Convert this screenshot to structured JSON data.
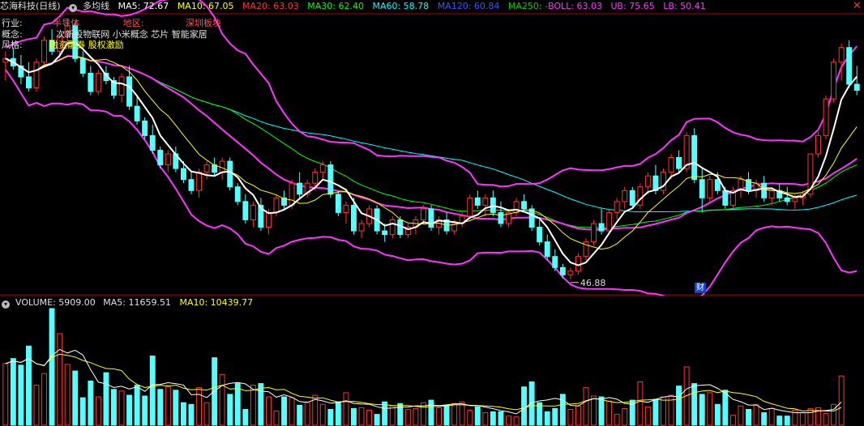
{
  "header": {
    "stock_title": "芯海科技(日线)",
    "indicator_name": "多均线",
    "ma_values": [
      {
        "label": "MA5: 72.67",
        "color": "#ffffff"
      },
      {
        "label": "MA10: 67.05",
        "color": "#ffff00"
      },
      {
        "label": "MA20: 63.03",
        "color": "#ff3333"
      },
      {
        "label": "MA30: 62.40",
        "color": "#00ff00"
      },
      {
        "label": "MA60: 58.78",
        "color": "#00ffff"
      },
      {
        "label": "MA120: 60.84",
        "color": "#3355ff"
      },
      {
        "label": "MA250: -",
        "color": "#00cc00"
      }
    ],
    "boll": {
      "label": "BOLL: 63.03",
      "ub": "UB: 75.65",
      "lb": "LB: 50.41",
      "color": "#ff33ff"
    }
  },
  "info": {
    "industry_label": "行业:",
    "industry_value": "半导体",
    "region_label": "地区:",
    "region_value": "深圳板块",
    "concept_label": "概念:",
    "concept_value": "次新股物联网 小米概念 芯片 智能家居",
    "style_label": "风格:",
    "style_value": "融资融券 股权激励"
  },
  "annotations": {
    "low_marker": "46.88",
    "finance_badge": "财"
  },
  "volume": {
    "label": "VOLUME: 5909.00",
    "ma5": "MA5: 11659.51",
    "ma10": "MA10: 10439.77"
  },
  "colors": {
    "up": "#ff3232",
    "down": "#54ffff",
    "ma5": "#ffffff",
    "ma10": "#ffff00",
    "ma30": "#00ff00",
    "ma60": "#00ffff",
    "ma120": "#3355ff",
    "boll": "#ff33ff",
    "frame": "#b40000"
  },
  "chart_data": {
    "type": "candlestick",
    "title": "芯海科技(日线)",
    "price_range": [
      45,
      83
    ],
    "candles": [
      [
        76.5,
        78.0,
        74.0,
        77.0
      ],
      [
        77.0,
        78.5,
        75.5,
        76.0
      ],
      [
        76.0,
        77.5,
        73.5,
        74.5
      ],
      [
        74.5,
        76.5,
        72.5,
        73.0
      ],
      [
        73.0,
        77.0,
        72.5,
        76.5
      ],
      [
        76.5,
        80.0,
        76.0,
        79.5
      ],
      [
        79.5,
        81.0,
        77.5,
        78.0
      ],
      [
        78.0,
        80.5,
        77.0,
        80.0
      ],
      [
        80.0,
        82.5,
        78.5,
        81.5
      ],
      [
        81.5,
        82.0,
        76.5,
        77.0
      ],
      [
        77.0,
        78.0,
        74.5,
        75.0
      ],
      [
        75.0,
        76.0,
        72.0,
        72.5
      ],
      [
        72.5,
        75.5,
        72.0,
        75.0
      ],
      [
        75.0,
        76.0,
        73.5,
        74.0
      ],
      [
        74.0,
        74.5,
        71.5,
        72.0
      ],
      [
        72.0,
        75.0,
        71.0,
        74.5
      ],
      [
        74.5,
        76.0,
        70.0,
        70.5
      ],
      [
        70.5,
        72.0,
        68.0,
        68.5
      ],
      [
        68.5,
        69.0,
        66.0,
        66.5
      ],
      [
        66.5,
        68.0,
        64.0,
        64.5
      ],
      [
        64.5,
        65.0,
        62.0,
        62.5
      ],
      [
        62.5,
        64.5,
        61.5,
        64.0
      ],
      [
        64.0,
        65.0,
        61.5,
        62.0
      ],
      [
        62.0,
        63.0,
        60.0,
        60.5
      ],
      [
        60.5,
        61.5,
        58.5,
        59.0
      ],
      [
        59.0,
        62.0,
        58.0,
        61.5
      ],
      [
        61.5,
        63.0,
        60.5,
        62.5
      ],
      [
        62.5,
        63.5,
        61.0,
        61.5
      ],
      [
        61.5,
        63.5,
        60.5,
        63.0
      ],
      [
        63.0,
        63.5,
        59.0,
        59.5
      ],
      [
        59.5,
        60.0,
        57.0,
        57.5
      ],
      [
        57.5,
        58.5,
        54.5,
        55.0
      ],
      [
        55.0,
        57.5,
        54.0,
        57.0
      ],
      [
        57.0,
        58.0,
        53.5,
        54.0
      ],
      [
        54.0,
        56.5,
        53.0,
        56.0
      ],
      [
        56.0,
        58.5,
        55.5,
        58.0
      ],
      [
        58.0,
        59.0,
        56.5,
        57.0
      ],
      [
        57.0,
        60.5,
        56.5,
        60.0
      ],
      [
        60.0,
        61.5,
        58.0,
        58.5
      ],
      [
        58.5,
        60.5,
        58.0,
        60.0
      ],
      [
        60.0,
        62.0,
        59.0,
        61.5
      ],
      [
        61.5,
        63.0,
        60.5,
        62.5
      ],
      [
        62.5,
        63.0,
        58.0,
        58.5
      ],
      [
        58.5,
        59.0,
        55.5,
        56.0
      ],
      [
        56.0,
        57.5,
        54.5,
        57.0
      ],
      [
        57.0,
        58.0,
        53.0,
        53.5
      ],
      [
        53.5,
        55.0,
        52.5,
        54.5
      ],
      [
        54.5,
        57.0,
        54.0,
        56.5
      ],
      [
        56.5,
        57.0,
        53.0,
        53.5
      ],
      [
        53.5,
        54.5,
        52.0,
        53.0
      ],
      [
        53.0,
        55.5,
        52.5,
        55.0
      ],
      [
        55.0,
        55.5,
        52.5,
        53.0
      ],
      [
        53.0,
        54.5,
        52.5,
        54.0
      ],
      [
        54.0,
        55.5,
        53.0,
        55.0
      ],
      [
        55.0,
        57.0,
        54.5,
        56.5
      ],
      [
        56.5,
        57.0,
        53.5,
        54.0
      ],
      [
        54.0,
        55.5,
        53.0,
        55.0
      ],
      [
        55.0,
        56.0,
        53.0,
        53.5
      ],
      [
        53.5,
        55.0,
        53.0,
        54.5
      ],
      [
        54.5,
        56.0,
        54.0,
        55.5
      ],
      [
        55.5,
        58.5,
        55.0,
        58.0
      ],
      [
        58.0,
        59.0,
        56.5,
        57.0
      ],
      [
        57.0,
        58.5,
        55.5,
        58.0
      ],
      [
        58.0,
        59.0,
        55.5,
        56.0
      ],
      [
        56.0,
        57.5,
        54.0,
        54.5
      ],
      [
        54.5,
        56.5,
        54.0,
        56.0
      ],
      [
        56.0,
        58.0,
        55.5,
        57.5
      ],
      [
        57.5,
        58.5,
        56.0,
        56.5
      ],
      [
        56.5,
        57.0,
        53.5,
        54.0
      ],
      [
        54.0,
        55.0,
        51.5,
        52.0
      ],
      [
        52.0,
        53.0,
        49.5,
        50.0
      ],
      [
        50.0,
        51.0,
        48.0,
        48.5
      ],
      [
        48.5,
        49.0,
        47.0,
        47.5
      ],
      [
        47.5,
        48.5,
        46.9,
        48.0
      ],
      [
        48.0,
        50.5,
        47.5,
        50.0
      ],
      [
        50.0,
        52.5,
        49.5,
        52.0
      ],
      [
        52.0,
        55.0,
        51.5,
        54.5
      ],
      [
        54.5,
        56.5,
        53.0,
        53.5
      ],
      [
        53.5,
        56.5,
        53.0,
        56.0
      ],
      [
        56.0,
        58.0,
        55.0,
        57.5
      ],
      [
        57.5,
        59.5,
        56.5,
        59.0
      ],
      [
        59.0,
        59.5,
        56.5,
        57.0
      ],
      [
        57.0,
        60.0,
        56.5,
        59.5
      ],
      [
        59.5,
        61.5,
        58.5,
        61.0
      ],
      [
        61.0,
        62.5,
        58.5,
        59.0
      ],
      [
        59.0,
        62.0,
        58.5,
        61.5
      ],
      [
        61.5,
        64.0,
        60.5,
        63.5
      ],
      [
        63.5,
        64.5,
        61.5,
        62.0
      ],
      [
        62.0,
        67.0,
        61.5,
        66.5
      ],
      [
        66.5,
        67.5,
        60.0,
        60.5
      ],
      [
        60.5,
        62.0,
        56.0,
        58.0
      ],
      [
        58.0,
        61.0,
        57.5,
        60.5
      ],
      [
        60.5,
        61.5,
        58.5,
        59.0
      ],
      [
        59.0,
        59.5,
        56.5,
        57.0
      ],
      [
        57.0,
        59.5,
        56.5,
        59.0
      ],
      [
        59.0,
        61.0,
        58.0,
        60.5
      ],
      [
        60.5,
        61.5,
        58.5,
        59.0
      ],
      [
        59.0,
        60.5,
        58.0,
        60.0
      ],
      [
        60.0,
        61.0,
        57.5,
        58.0
      ],
      [
        58.0,
        59.5,
        57.0,
        59.0
      ],
      [
        59.0,
        60.0,
        57.5,
        58.0
      ],
      [
        58.0,
        59.5,
        57.0,
        57.5
      ],
      [
        57.5,
        58.5,
        56.5,
        58.0
      ],
      [
        58.0,
        59.0,
        57.0,
        58.5
      ],
      [
        58.5,
        64.0,
        58.0,
        64.0
      ],
      [
        64.0,
        67.0,
        63.5,
        66.5
      ],
      [
        66.5,
        72.0,
        66.0,
        71.5
      ],
      [
        71.5,
        77.0,
        71.0,
        76.5
      ],
      [
        76.5,
        79.0,
        74.0,
        78.5
      ],
      [
        78.5,
        79.5,
        73.0,
        73.5
      ],
      [
        73.5,
        76.0,
        72.0,
        72.67
      ]
    ],
    "low_marker_value": 46.88,
    "volume_range": [
      0,
      14000
    ],
    "volume": [
      7400,
      8000,
      7200,
      9500,
      4800,
      6200,
      14000,
      11000,
      7300,
      6500,
      3300,
      5300,
      3400,
      6300,
      4300,
      4100,
      3600,
      4800,
      3500,
      8300,
      4300,
      4600,
      4200,
      2700,
      2500,
      4500,
      2700,
      8100,
      6100,
      3700,
      5000,
      1900,
      4800,
      5000,
      3400,
      1700,
      3400,
      3300,
      2400,
      2800,
      3600,
      2500,
      1900,
      2800,
      3900,
      2000,
      2100,
      1800,
      1300,
      2800,
      2300,
      2600,
      1900,
      2000,
      2700,
      3000,
      2100,
      2400,
      2600,
      2800,
      1800,
      2200,
      1500,
      1600,
      1600,
      1100,
      1000,
      4600,
      5200,
      2700,
      1600,
      2000,
      3700,
      1900,
      2300,
      4500,
      3500,
      3400,
      2900,
      1300,
      2000,
      3000,
      5200,
      2200,
      3100,
      3400,
      3600,
      4700,
      7000,
      5000,
      3700,
      3900,
      2500,
      4200,
      1200,
      2300,
      1900,
      2500,
      1500,
      2000,
      1100,
      1100,
      1800,
      1500,
      2000,
      2100,
      1400,
      2500,
      5909
    ]
  }
}
